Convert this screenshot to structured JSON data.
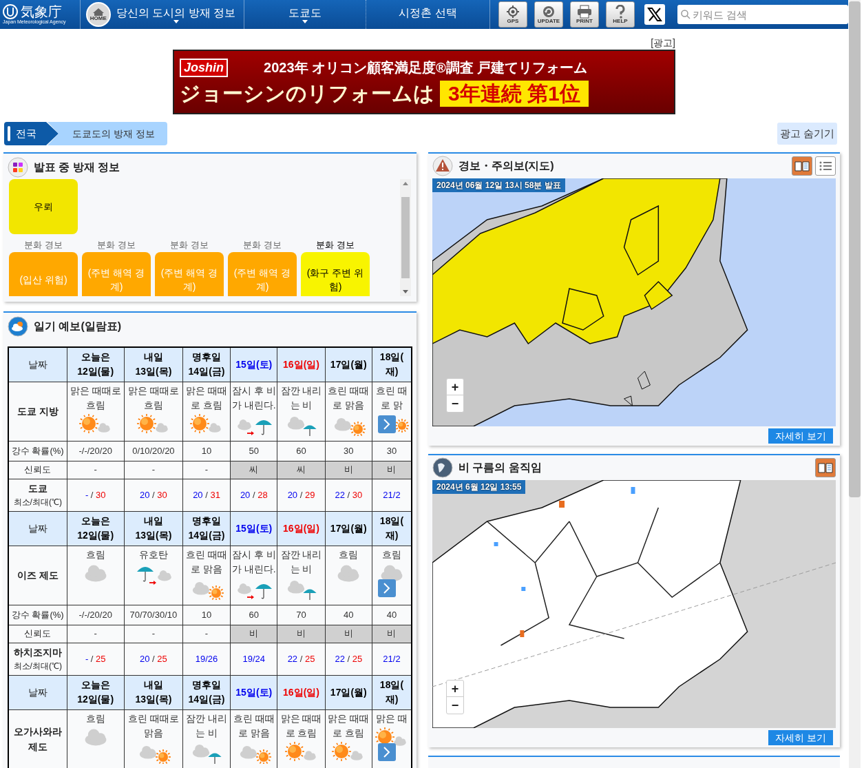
{
  "header": {
    "logo": {
      "kanji": "気象庁",
      "english": "Japan Meteorological Agency"
    },
    "home_label": "HOME",
    "nav": [
      {
        "label": "당신의 도시의 방재 정보",
        "dropdown": true
      },
      {
        "label": "도쿄도",
        "dropdown": true
      },
      {
        "label": "시정촌 선택",
        "dropdown": false
      }
    ],
    "tools": [
      {
        "label": "GPS",
        "kind": "gps"
      },
      {
        "label": "UPDATE",
        "kind": "update"
      },
      {
        "label": "PRINT",
        "kind": "print"
      },
      {
        "label": "HELP",
        "kind": "help"
      }
    ],
    "search": {
      "placeholder": "키워드 검색"
    }
  },
  "ad": {
    "label": "[광고]",
    "brand": "Joshin",
    "headline": "2023年 オリコン顧客満足度®調査 戸建てリフォーム",
    "slogan": "ジョーシンのリフォームは",
    "badge": "3年連続 第1位"
  },
  "breadcrumb": [
    {
      "label": "전국",
      "kind": "root"
    },
    {
      "label": "도쿄도의 방재 정보",
      "kind": "current"
    }
  ],
  "hide_ad_button": "광고 숨기기",
  "warnings": {
    "title": "발표 중 방재 정보",
    "tiles": [
      {
        "text": "우뢰",
        "kind": "advisory"
      },
      {
        "caption": "분화 경보",
        "text": "(입산 위험)",
        "kind": "warning"
      },
      {
        "caption": "분화 경보",
        "text": "(주변 해역 경계)",
        "kind": "warning"
      },
      {
        "caption": "분화 경보",
        "text": "(주변 해역 경계)",
        "kind": "warning"
      },
      {
        "caption": "분화 경보",
        "text": "(주변 해역 경계)",
        "kind": "warning"
      },
      {
        "caption": "분화 경보",
        "text": "(화구 주변 위험)",
        "kind": "advisory"
      }
    ]
  },
  "forecast": {
    "title": "일기 예보(일람표)",
    "blocks": [
      {
        "date_label": "날짜",
        "days": [
          {
            "top": "오늘은",
            "date": "12일(물)",
            "color": "#000000"
          },
          {
            "top": "내일",
            "date": "13일(목)",
            "color": "#000000"
          },
          {
            "top": "명후일",
            "date": "14일(금)",
            "color": "#000000"
          },
          {
            "date": "15일(토)",
            "color": "#0000ee"
          },
          {
            "date": "16일(일)",
            "color": "#ee0000"
          },
          {
            "date": "17일(월)",
            "color": "#000000"
          },
          {
            "top": "18일(",
            "date": "재)",
            "color": "#000000"
          }
        ],
        "region": "도쿄 지방",
        "weather": [
          {
            "text": "맑은 때때로 흐림",
            "kind": "sun-cloud"
          },
          {
            "text": "맑은 때때로 흐림",
            "kind": "sun-cloud"
          },
          {
            "text": "맑은 때때로 흐림",
            "kind": "sun-cloud"
          },
          {
            "text": "잠시 후 비가 내린다.",
            "kind": "cloud-then-rain"
          },
          {
            "text": "잠깐 내리는 비",
            "kind": "cloud-umbrella"
          },
          {
            "text": "흐린 때때로 맑음",
            "kind": "cloud-sun"
          },
          {
            "text": "흐린 때 로 맑",
            "kind": "sun"
          }
        ],
        "rows": [
          {
            "label": "강수 확률(%)",
            "kind": "text",
            "cells": [
              {
                "text": "-/-/20/20"
              },
              {
                "text": "0/10/20/20"
              },
              {
                "text": "10"
              },
              {
                "text": "50"
              },
              {
                "text": "60"
              },
              {
                "text": "30"
              },
              {
                "text": "30"
              }
            ]
          },
          {
            "label": "신뢰도",
            "kind": "grade",
            "cells": [
              {
                "text": "-",
                "shaded": false
              },
              {
                "text": "-",
                "shaded": false
              },
              {
                "text": "-",
                "shaded": false
              },
              {
                "text": "씨",
                "shaded": true
              },
              {
                "text": "씨",
                "shaded": true
              },
              {
                "text": "비",
                "shaded": true
              },
              {
                "text": "비",
                "shaded": true
              }
            ]
          }
        ],
        "temp": {
          "place": "도쿄",
          "label": "최소/최대(℃)",
          "cells": [
            {
              "min": "-",
              "sep": " / ",
              "max": "30"
            },
            {
              "min": "20",
              "sep": " / ",
              "max": "30"
            },
            {
              "min": "20",
              "sep": " / ",
              "max": "31"
            },
            {
              "min": "20",
              "sep": " / ",
              "max": "28"
            },
            {
              "min": "20",
              "sep": " / ",
              "max": "29"
            },
            {
              "min": "22",
              "sep": " / ",
              "max": "30"
            },
            {
              "min": "21/2"
            }
          ]
        }
      },
      {
        "date_label": "날짜",
        "days": [
          {
            "top": "오늘은",
            "date": "12일(물)",
            "color": "#000000"
          },
          {
            "top": "내일",
            "date": "13일(목)",
            "color": "#000000"
          },
          {
            "top": "명후일",
            "date": "14일(금)",
            "color": "#000000"
          },
          {
            "date": "15일(토)",
            "color": "#0000ee"
          },
          {
            "date": "16일(일)",
            "color": "#ee0000"
          },
          {
            "date": "17일(월)",
            "color": "#000000"
          },
          {
            "top": "18일(",
            "date": "재)",
            "color": "#000000"
          }
        ],
        "region": "이즈 제도",
        "weather": [
          {
            "text": "흐림",
            "kind": "cloud"
          },
          {
            "text": "유호탄",
            "kind": "rain-then-cloud"
          },
          {
            "text": "흐린 때때로 맑음",
            "kind": "cloud-sun"
          },
          {
            "text": "잠시 후 비가 내린다.",
            "kind": "cloud-then-rain"
          },
          {
            "text": "잠깐 내리는 비",
            "kind": "cloud-umbrella"
          },
          {
            "text": "흐림",
            "kind": "cloud"
          },
          {
            "text": "흐림",
            "kind": "cloud"
          }
        ],
        "rows": [
          {
            "label": "강수 확률(%)",
            "kind": "text",
            "cells": [
              {
                "text": "-/-/20/20"
              },
              {
                "text": "70/70/30/10"
              },
              {
                "text": "10"
              },
              {
                "text": "60"
              },
              {
                "text": "70"
              },
              {
                "text": "40"
              },
              {
                "text": "40"
              }
            ]
          },
          {
            "label": "신뢰도",
            "kind": "grade",
            "cells": [
              {
                "text": "-",
                "shaded": false
              },
              {
                "text": "-",
                "shaded": false
              },
              {
                "text": "-",
                "shaded": false
              },
              {
                "text": "비",
                "shaded": true
              },
              {
                "text": "비",
                "shaded": true
              },
              {
                "text": "비",
                "shaded": true
              },
              {
                "text": "비",
                "shaded": true
              }
            ]
          }
        ],
        "temp": {
          "place": "하치조지마",
          "label": "최소/최대(℃)",
          "cells": [
            {
              "min": "-",
              "sep": " / ",
              "max": "25"
            },
            {
              "min": "20",
              "sep": " / ",
              "max": "25"
            },
            {
              "min": "19/26"
            },
            {
              "min": "19/24"
            },
            {
              "min": "22",
              "sep": " / ",
              "max": "25"
            },
            {
              "min": "22",
              "sep": " / ",
              "max": "25"
            },
            {
              "min": "21/2"
            }
          ]
        }
      },
      {
        "date_label": "날짜",
        "days": [
          {
            "top": "오늘은",
            "date": "12일(물)",
            "color": "#000000"
          },
          {
            "top": "내일",
            "date": "13일(목)",
            "color": "#000000"
          },
          {
            "top": "명후일",
            "date": "14일(금)",
            "color": "#000000"
          },
          {
            "date": "15일(토)",
            "color": "#0000ee"
          },
          {
            "date": "16일(일)",
            "color": "#ee0000"
          },
          {
            "date": "17일(월)",
            "color": "#000000"
          },
          {
            "top": "18일(",
            "date": "재)",
            "color": "#000000"
          }
        ],
        "region": "오가사와라 제도",
        "weather": [
          {
            "text": "흐림",
            "kind": "cloud"
          },
          {
            "text": "흐린 때때로 맑음",
            "kind": "cloud-sun"
          },
          {
            "text": "잠깐 내리는 비",
            "kind": "cloud-umbrella"
          },
          {
            "text": "흐린 때때로 맑음",
            "kind": "cloud-sun"
          },
          {
            "text": "맑은 때때로 흐림",
            "kind": "sun-cloud"
          },
          {
            "text": "맑은 때때로 흐림",
            "kind": "sun-cloud"
          },
          {
            "text": "맑은 때",
            "kind": "sun-cloud"
          }
        ]
      }
    ]
  },
  "map_panels": [
    {
      "kind": "warning",
      "title": "경보・주의보(지도)",
      "buttons": [
        {
          "kind": "book"
        },
        {
          "kind": "list"
        }
      ],
      "timestamp": "2024년 06월 12일 13시 58분 발표",
      "zoom_in": "+",
      "zoom_out": "−",
      "more_button": "자세히 보기"
    },
    {
      "kind": "radar",
      "title": "비 구름의 움직임",
      "buttons": [
        {
          "kind": "book"
        }
      ],
      "timestamp": "2024년 6월 12일 13:55",
      "zoom_in": "+",
      "zoom_out": "−",
      "more_button": "자세히 보기"
    }
  ]
}
